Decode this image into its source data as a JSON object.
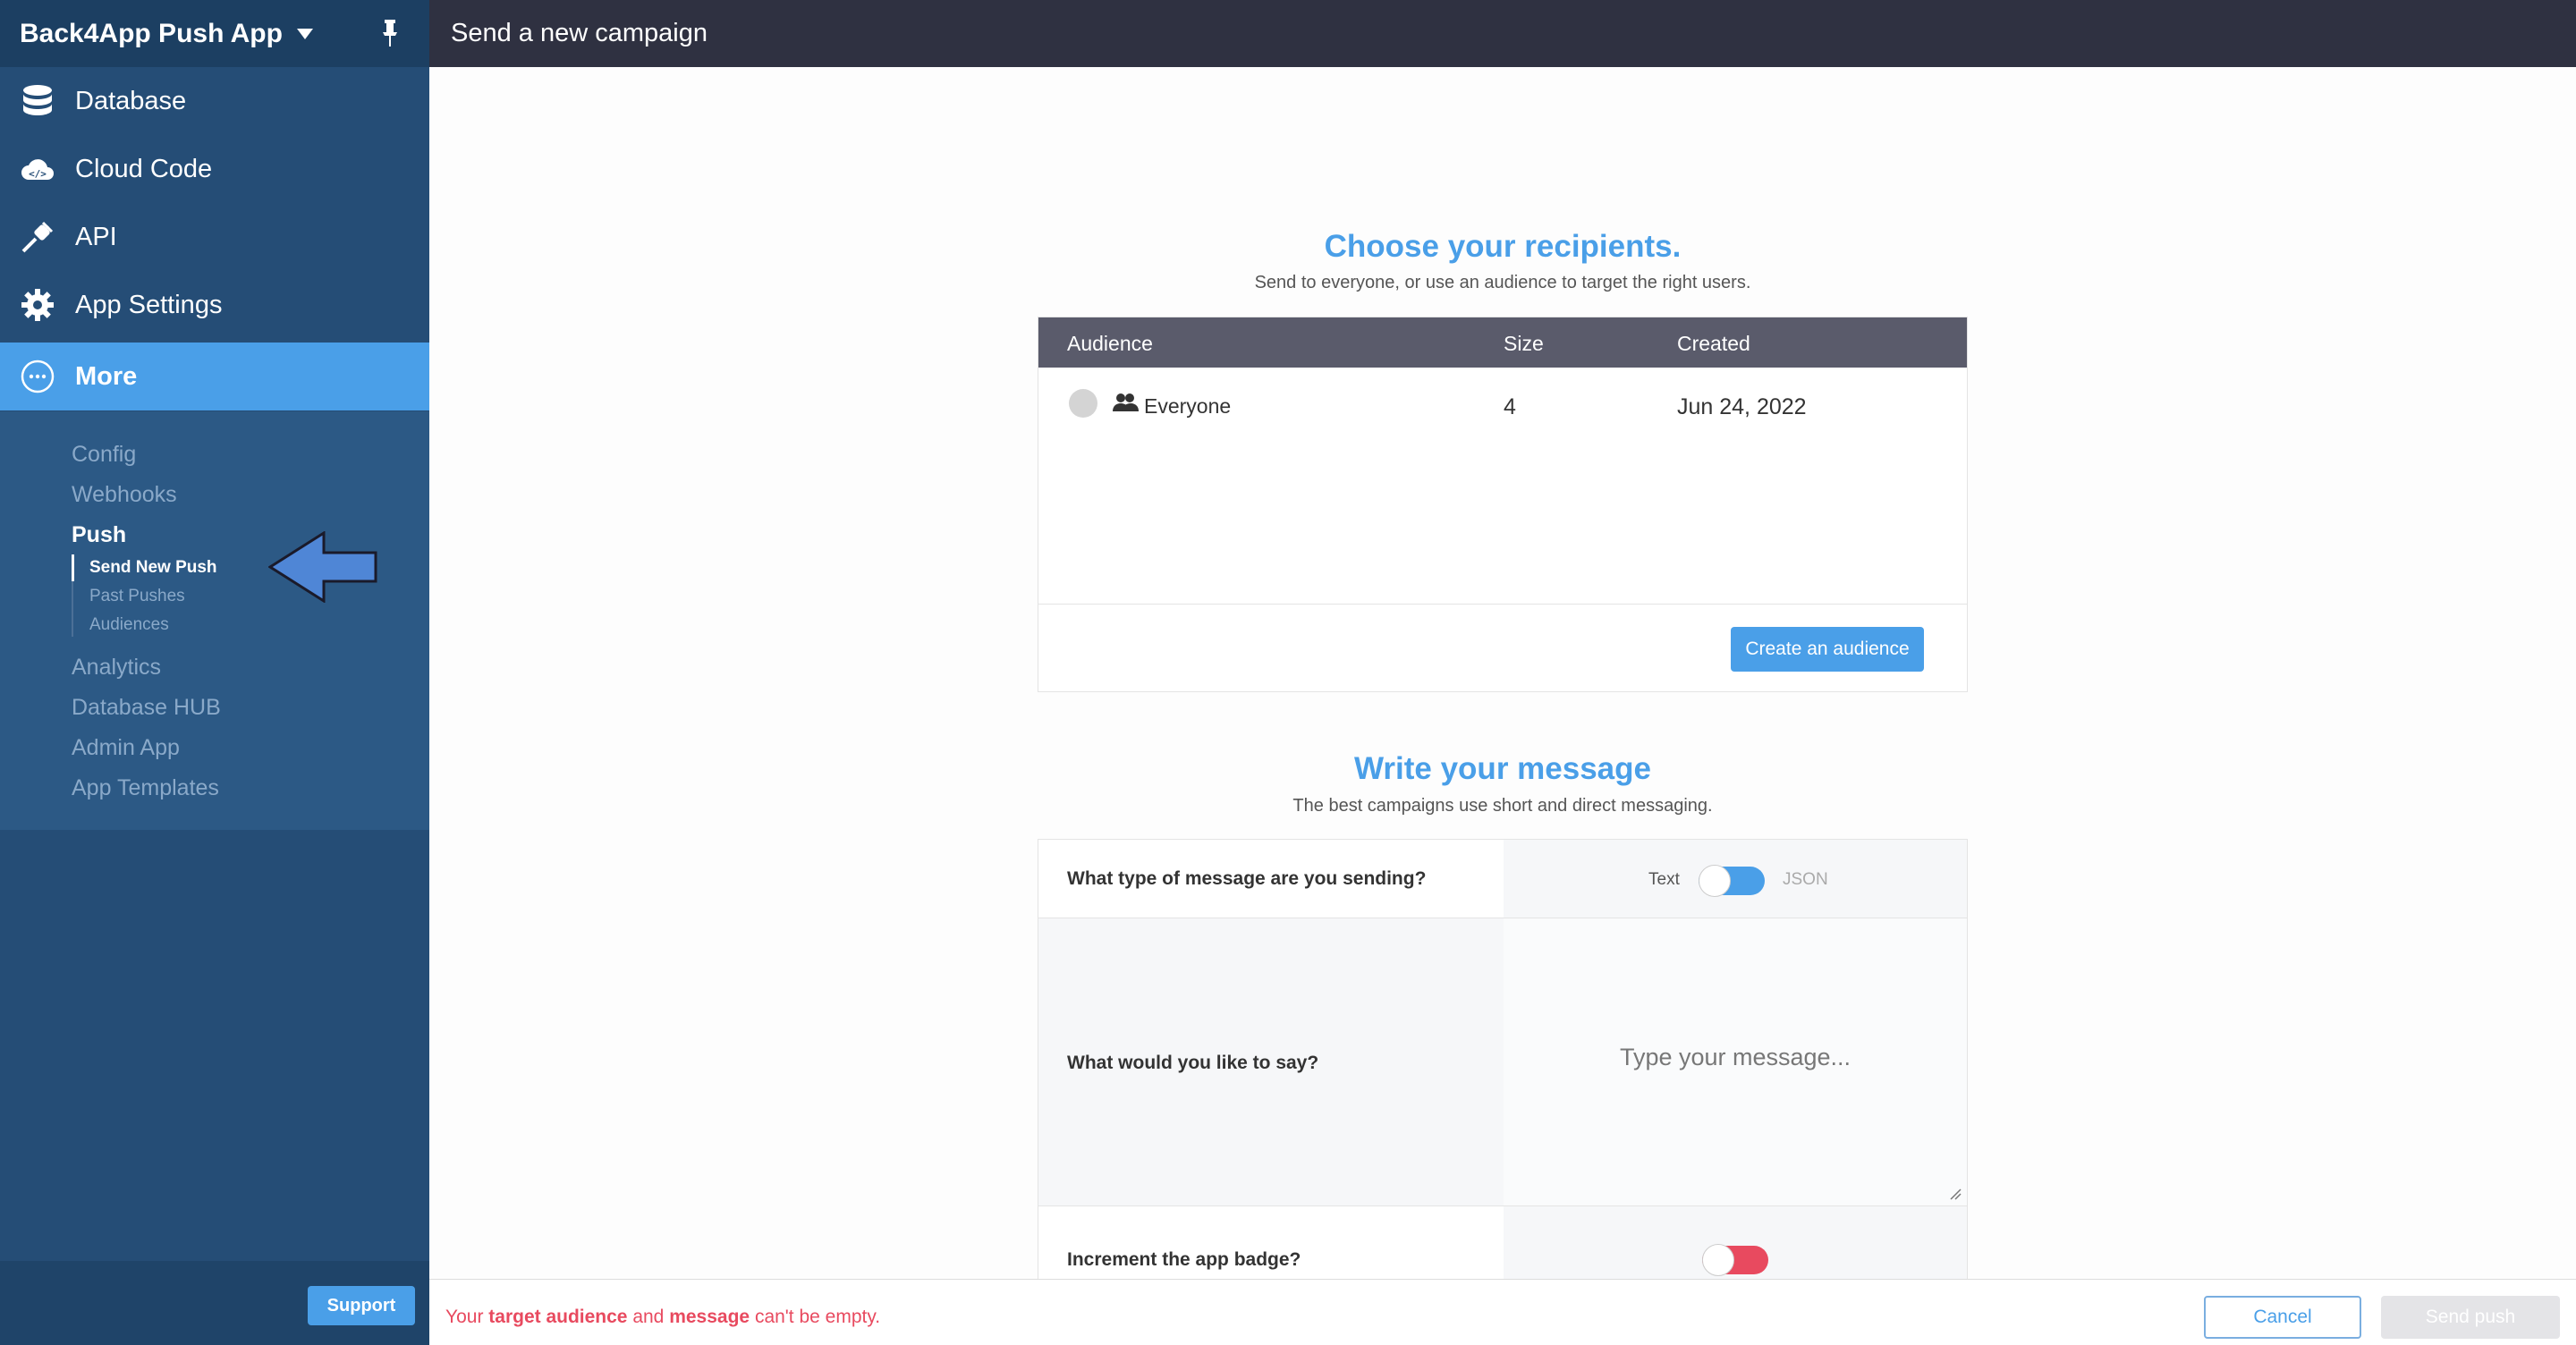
{
  "app": {
    "name": "Back4App Push App"
  },
  "nav": {
    "items": [
      {
        "label": "Database",
        "icon": "database-icon"
      },
      {
        "label": "Cloud Code",
        "icon": "cloud-code-icon"
      },
      {
        "label": "API",
        "icon": "plug-icon"
      },
      {
        "label": "App Settings",
        "icon": "gear-icon"
      },
      {
        "label": "More",
        "icon": "more-icon"
      }
    ],
    "more_sub": [
      "Config",
      "Webhooks",
      "Push",
      "Analytics",
      "Database HUB",
      "Admin App",
      "App Templates"
    ],
    "push_sub": [
      "Send New Push",
      "Past Pushes",
      "Audiences"
    ]
  },
  "sidebar": {
    "support_label": "Support"
  },
  "topbar": {
    "title": "Send a new campaign"
  },
  "recipients": {
    "heading": "Choose your recipients.",
    "subheading": "Send to everyone, or use an audience to target the right users.",
    "columns": [
      "Audience",
      "Size",
      "Created"
    ],
    "rows": [
      {
        "name": "Everyone",
        "size": "4",
        "created": "Jun 24, 2022"
      }
    ],
    "create_button": "Create an audience"
  },
  "message": {
    "heading": "Write your message",
    "subheading": "The best campaigns use short and direct messaging.",
    "type_label": "What type of message are you sending?",
    "type_option_text": "Text",
    "type_option_json": "JSON",
    "say_label": "What would you like to say?",
    "say_placeholder": "Type your message...",
    "badge_label": "Increment the app badge?"
  },
  "footer": {
    "error_prefix": "Your ",
    "error_audience": "target audience",
    "error_and": " and ",
    "error_message": "message",
    "error_suffix": " can't be empty.",
    "cancel_label": "Cancel",
    "send_label": "Send push"
  },
  "colors": {
    "accent": "#4a9fe8",
    "sidebar": "#254d76",
    "error": "#e84a5f"
  }
}
